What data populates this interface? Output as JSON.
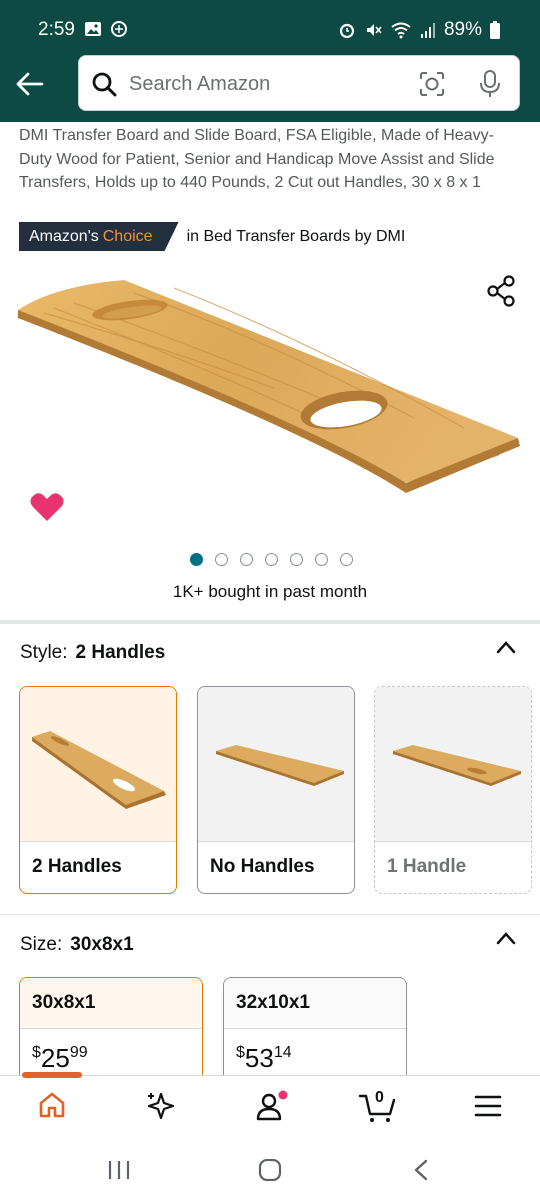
{
  "status_bar": {
    "time": "2:59",
    "battery": "89%"
  },
  "search": {
    "placeholder": "Search Amazon"
  },
  "product": {
    "title": "DMI Transfer Board and Slide Board, FSA Eligible, Made of Heavy-Duty Wood for Patient, Senior and Handicap Move Assist and Slide Transfers, Holds up to 440 Pounds, 2 Cut out Handles, 30 x 8 x 1",
    "badge_part1": "Amazon's",
    "badge_part2": "Choice",
    "badge_category": "in Bed Transfer Boards by DMI",
    "image_count": 7,
    "active_image": 1,
    "bought_text": "1K+ bought in past month"
  },
  "style": {
    "label": "Style:",
    "selected": "2 Handles",
    "options": [
      {
        "label": "2 Handles",
        "state": "selected"
      },
      {
        "label": "No Handles",
        "state": "available"
      },
      {
        "label": "1 Handle",
        "state": "unavailable"
      }
    ]
  },
  "size": {
    "label": "Size:",
    "selected": "30x8x1",
    "options": [
      {
        "label": "30x8x1",
        "currency": "$",
        "whole": "25",
        "fraction": "99",
        "state": "selected"
      },
      {
        "label": "32x10x1",
        "currency": "$",
        "whole": "53",
        "fraction": "14",
        "state": "available"
      }
    ]
  },
  "bottom_nav": {
    "items": [
      "home-icon",
      "sparkle-icon",
      "account-icon",
      "cart-icon",
      "menu-icon"
    ],
    "cart_count": "0"
  },
  "colors": {
    "header": "#0c4a43",
    "accent": "#e77600",
    "badge": "#232f3e",
    "badge_choice": "#f29136",
    "heart": "#e8336e",
    "dot_active": "#007185"
  }
}
